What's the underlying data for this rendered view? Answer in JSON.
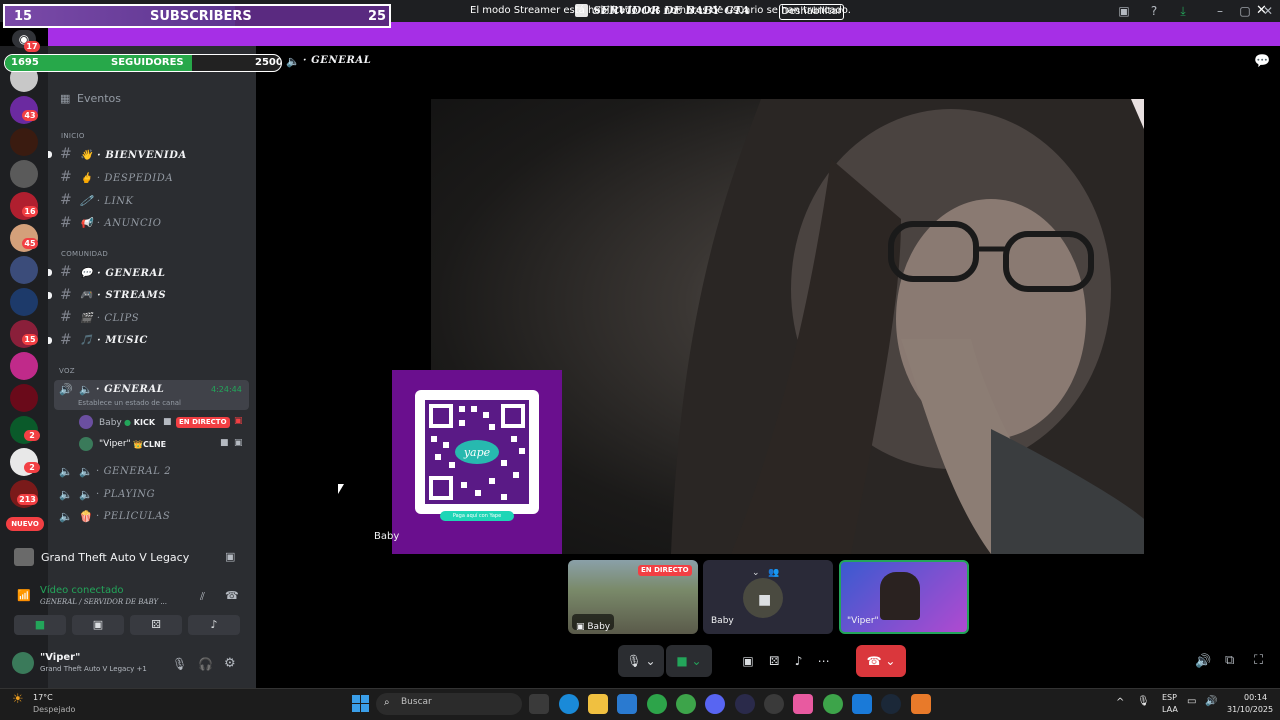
{
  "titlebar": {
    "title": "SERVIDOR DE BABY GTA"
  },
  "banner": {
    "text": "El modo Streamer está habilitado. Los nombres de usuario se han truncado.",
    "button": "Deshabilitar",
    "close": "✕"
  },
  "overlays": {
    "subscribers": {
      "current": "15",
      "label": "SUBSCRIBERS",
      "goal": "25",
      "progress": 0.6
    },
    "followers": {
      "current": "1695",
      "label": "SEGUIDORES",
      "goal": "2500",
      "progress": 0.678
    }
  },
  "rail": {
    "badges": [
      "17",
      "43",
      "16",
      "45",
      "15",
      "2",
      "2",
      "213"
    ],
    "new_label": "NUEVO"
  },
  "sidebar": {
    "events": "Eventos",
    "categories": {
      "inicio": "INICIO",
      "comunidad": "COMUNIDAD",
      "voz": "VOZ"
    },
    "text_channels": [
      {
        "emoji": "👋",
        "name": "BIENVENIDA",
        "bold": true
      },
      {
        "emoji": "🖕",
        "name": "DESPEDIDA",
        "bold": false
      },
      {
        "emoji": "🧷",
        "name": "LINK",
        "bold": false
      },
      {
        "emoji": "📢",
        "name": "ANUNCIO",
        "bold": false
      },
      {
        "emoji": "💬",
        "name": "GENERAL",
        "bold": true
      },
      {
        "emoji": "🎮",
        "name": "STREAMS",
        "bold": true
      },
      {
        "emoji": "🎬",
        "name": "CLIPS",
        "bold": false
      },
      {
        "emoji": "🎵",
        "name": "MUSIC",
        "bold": true
      }
    ],
    "voice_active": {
      "name": "GENERAL",
      "time": "4:24:44",
      "status": "Establece un estado de canal"
    },
    "members": [
      {
        "name": "Baby",
        "tag": "KICK",
        "live": "EN DIRECTO"
      },
      {
        "name": "\"Viper\"",
        "tag": "CLNE"
      }
    ],
    "voice_channels": [
      "GENERAL 2",
      "PLAYING",
      "PELICULAS"
    ]
  },
  "activity": {
    "game": "Grand Theft Auto V Legacy"
  },
  "rtc": {
    "status": "Vídeo conectado",
    "location": "GENERAL / SERVIDOR DE BABY ..."
  },
  "user": {
    "name": "\"Viper\"",
    "activity": "Grand Theft Auto V Legacy +1"
  },
  "main": {
    "channel": "GENERAL",
    "video_name": "Baby",
    "tiles": [
      {
        "name": "Baby",
        "badge": "EN DIRECTO"
      },
      {
        "name": "Baby"
      },
      {
        "name": "\"Viper\""
      }
    ],
    "qr_caption": "Paga aquí con Yape"
  },
  "taskbar": {
    "weather_temp": "17°C",
    "weather_desc": "Despejado",
    "search": "Buscar",
    "lang": "ESP",
    "lang2": "LAA",
    "time": "00:14",
    "date": "31/10/2025"
  },
  "colors": {
    "streamer_banner": "#a62fe6",
    "live_red": "#f23f43",
    "connected_green": "#23a55a",
    "hangup": "#da373c"
  }
}
